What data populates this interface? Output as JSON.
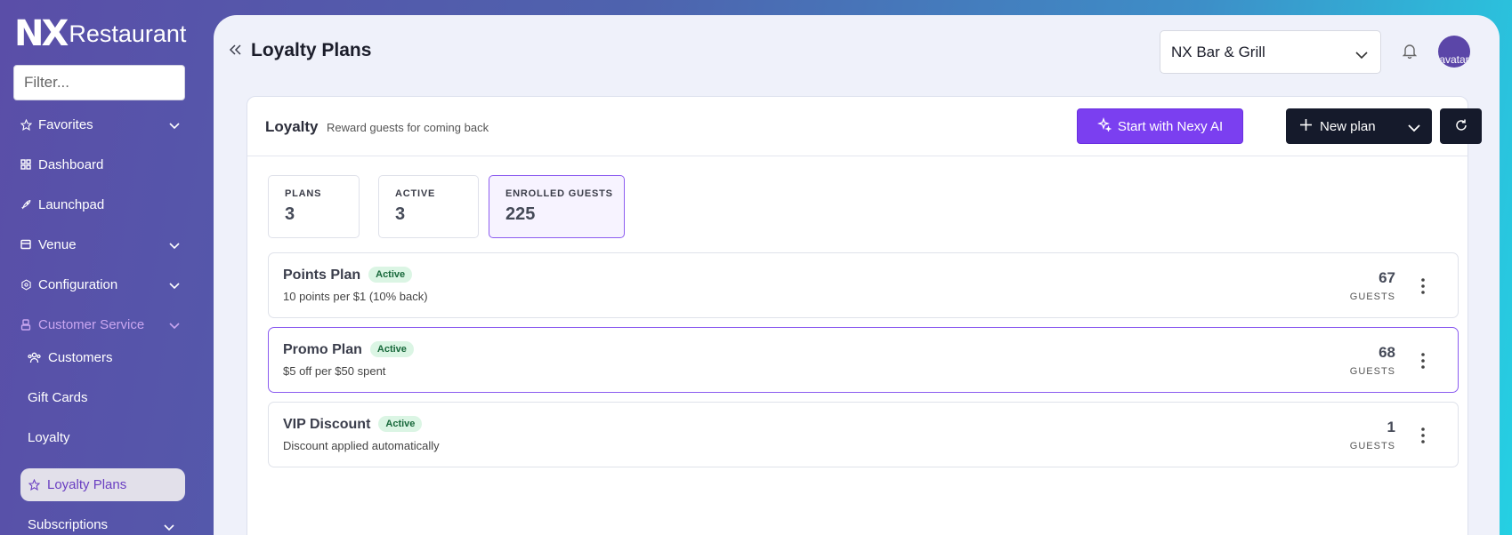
{
  "brand": {
    "mark": "NX",
    "name": "Restaurant"
  },
  "sidebar": {
    "filter_placeholder": "Filter...",
    "items": [
      {
        "label": "Favorites",
        "icon": "star-icon",
        "has_chevron": true
      },
      {
        "label": "Dashboard",
        "icon": "grid-icon",
        "has_chevron": false
      },
      {
        "label": "Launchpad",
        "icon": "rocket-icon",
        "has_chevron": false
      },
      {
        "label": "Venue",
        "icon": "store-icon",
        "has_chevron": true
      },
      {
        "label": "Configuration",
        "icon": "gear-icon",
        "has_chevron": true
      },
      {
        "label": "Customer Service",
        "icon": "person-icon",
        "has_chevron": true
      }
    ],
    "sub_items": [
      {
        "label": "Customers",
        "icon": "users-icon"
      },
      {
        "label": "Gift Cards"
      },
      {
        "label": "Loyalty"
      }
    ],
    "active_item": {
      "label": "Loyalty Plans",
      "icon": "star-icon"
    },
    "trailing_item": {
      "label": "Subscriptions",
      "has_chevron": true
    }
  },
  "header": {
    "title": "Loyalty Plans",
    "venue": "NX Bar & Grill",
    "avatar_alt": "avatar"
  },
  "card": {
    "title": "Loyalty",
    "subtitle": "Reward guests for coming back",
    "ai_button": "Start with Nexy AI",
    "new_button": "New plan"
  },
  "stats": [
    {
      "label": "PLANS",
      "value": "3"
    },
    {
      "label": "ACTIVE",
      "value": "3"
    },
    {
      "label": "ENROLLED GUESTS",
      "value": "225"
    }
  ],
  "plans": [
    {
      "name": "Points Plan",
      "status": "Active",
      "description": "10 points per $1 (10% back)",
      "guests": "67",
      "guests_label": "GUESTS"
    },
    {
      "name": "Promo Plan",
      "status": "Active",
      "description": "$5 off per $50 spent",
      "guests": "68",
      "guests_label": "GUESTS"
    },
    {
      "name": "VIP Discount",
      "status": "Active",
      "description": "Discount applied automatically",
      "guests": "1",
      "guests_label": "GUESTS"
    }
  ],
  "colors": {
    "accent": "#7b3ff0",
    "dark_button": "#151a2b",
    "active_badge_bg": "#dbf5e4",
    "active_badge_text": "#17683a"
  }
}
